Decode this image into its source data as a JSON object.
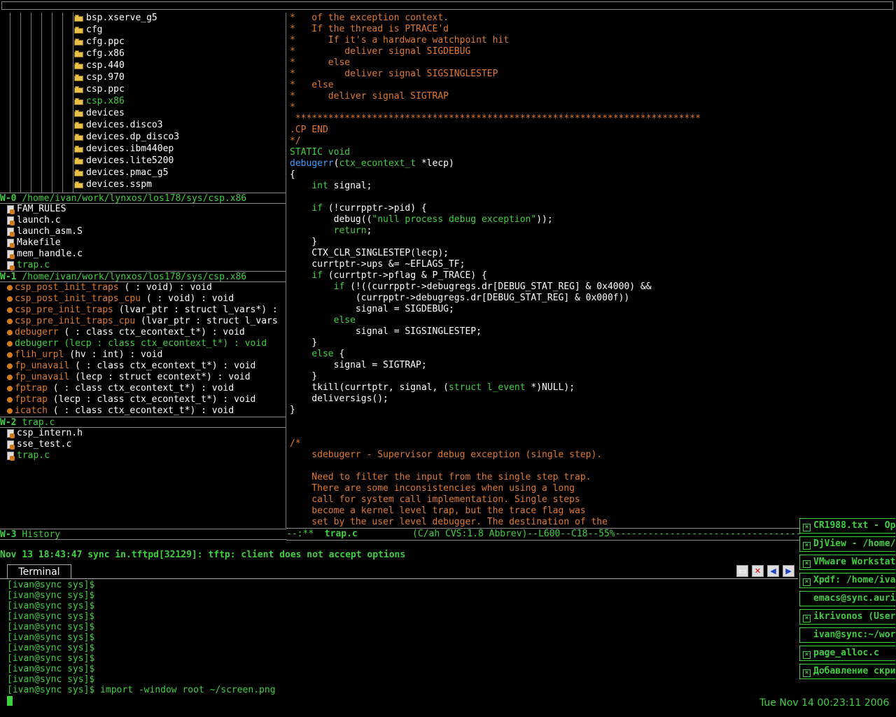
{
  "tree_items": [
    {
      "label": "bsp.xserve_g5",
      "color": "white"
    },
    {
      "label": "cfg",
      "color": "white"
    },
    {
      "label": "cfg.ppc",
      "color": "white"
    },
    {
      "label": "cfg.x86",
      "color": "white"
    },
    {
      "label": "csp.440",
      "color": "white"
    },
    {
      "label": "csp.970",
      "color": "white"
    },
    {
      "label": "csp.ppc",
      "color": "white"
    },
    {
      "label": "csp.x86",
      "color": "green"
    },
    {
      "label": "devices",
      "color": "white"
    },
    {
      "label": "devices.disco3",
      "color": "white"
    },
    {
      "label": "devices.dp_disco3",
      "color": "white"
    },
    {
      "label": "devices.ibm440ep",
      "color": "white"
    },
    {
      "label": "devices.lite5200",
      "color": "white"
    },
    {
      "label": "devices.pmac_g5",
      "color": "white"
    },
    {
      "label": "devices.sspm",
      "color": "white"
    }
  ],
  "w0": {
    "tag": "W-0",
    "path": "/home/ivan/work/lynxos/los178/sys/csp.x86"
  },
  "files": [
    {
      "label": "FAM_RULES",
      "color": "white"
    },
    {
      "label": "launch.c",
      "color": "white"
    },
    {
      "label": "launch_asm.S",
      "color": "white"
    },
    {
      "label": "Makefile",
      "color": "white"
    },
    {
      "label": "mem_handle.c",
      "color": "white"
    },
    {
      "label": "trap.c",
      "color": "green"
    }
  ],
  "w1": {
    "tag": "W-1",
    "path": "/home/ivan/work/lynxos/los178/sys/csp.x86"
  },
  "functions": [
    {
      "name": "csp_post_init_traps",
      "sig": " ( : void) : void"
    },
    {
      "name": "csp_post_init_traps_cpu",
      "sig": " ( : void) : void"
    },
    {
      "name": "csp_pre_init_traps",
      "sig": " (lvar_ptr : struct l_vars*) :"
    },
    {
      "name": "csp_pre_init_traps_cpu",
      "sig": " (lvar_ptr : struct l_vars"
    },
    {
      "name": "debugerr",
      "sig": " ( : class ctx_econtext_t*) : void"
    },
    {
      "name": "debugerr",
      "sig": " (lecp : class ctx_econtext_t*) : void",
      "color": "green"
    },
    {
      "name": "flih_urpl",
      "sig": " (hv : int) : void"
    },
    {
      "name": "fp_unavail",
      "sig": " ( : class ctx_econtext_t*) : void"
    },
    {
      "name": "fp_unavail",
      "sig": " (lecp : struct econtext*) : void"
    },
    {
      "name": "fptrap",
      "sig": " ( : class ctx_econtext_t*) : void"
    },
    {
      "name": "fptrap",
      "sig": " (lecp : class ctx_econtext_t*) : void"
    },
    {
      "name": "icatch",
      "sig": " ( : class ctx_econtext_t*) : void"
    }
  ],
  "w2": {
    "tag": "W-2",
    "path": "trap.c"
  },
  "history": [
    {
      "label": "csp_intern.h",
      "color": "white"
    },
    {
      "label": "sse_test.c",
      "color": "white"
    },
    {
      "label": "trap.c",
      "color": "green"
    }
  ],
  "w3": {
    "tag": "W-3",
    "path": "History"
  },
  "modeline": {
    "status": "--:**",
    "buffer": "trap.c",
    "info": "(C/ah CVS:1.8 Abbrev)--L600--C18--55%-----------------------------------"
  },
  "minibuffer": "Nov 13 18:43:47 sync in.tftpd[32129]: tftp: client does not accept options",
  "terminal": {
    "tab": "Terminal",
    "prompt": "[ivan@sync sys]$",
    "lines": [
      "",
      "",
      "",
      "",
      "",
      "",
      "",
      "",
      "",
      "",
      ""
    ],
    "command": "import -window root ~/screen.png"
  },
  "tasks": [
    {
      "label": "CR1988.txt - Op"
    },
    {
      "label": "DjView - /home/"
    },
    {
      "label": "VMware Workstat"
    },
    {
      "label": "Xpdf: /home/iva"
    },
    {
      "label": "emacs@sync.auri",
      "nocheck": true
    },
    {
      "label": "ikrivonos (User"
    },
    {
      "label": "ivan@sync:~/wor",
      "nocheck": true
    },
    {
      "label": "page_alloc.c"
    },
    {
      "label": "Добавление скри"
    }
  ],
  "clock": "Tue Nov 14 00:23:11 2006",
  "colors": {
    "green": "#3fd03f",
    "comment": "#e07a2a",
    "function": "#3aa0ff"
  }
}
